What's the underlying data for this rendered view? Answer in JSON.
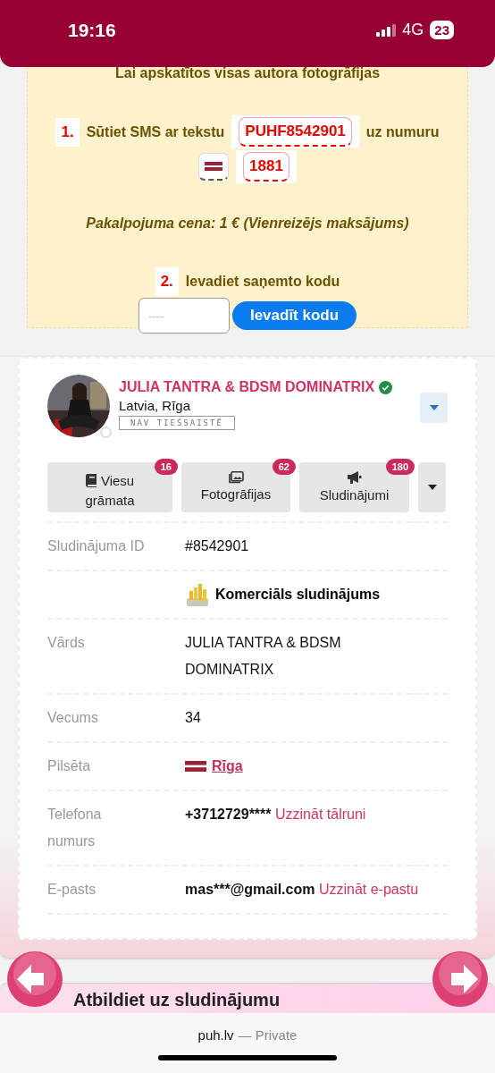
{
  "status_bar": {
    "time": "19:16",
    "network": "4G",
    "battery": "23"
  },
  "sms_box": {
    "heading": "Lai apskatītos visas autora fotogrāfijas",
    "step1": {
      "number": "1.",
      "text": "Sūtiet SMS ar tekstu",
      "code": "PUHF8542901",
      "after": "uz numuru",
      "phone": "1881"
    },
    "price": "Pakalpojuma cena: 1 € (Vienreizējs maksājums)",
    "step2": {
      "number": "2.",
      "text": "Ievadiet saņemto kodu",
      "placeholder": "----",
      "button": "Ievadīt kodu"
    }
  },
  "profile": {
    "name": "JULIA TANTRA & BDSM DOMINATRIX",
    "verified": true,
    "location": "Latvia, Rīga",
    "status": "NAV TIEŠSAISTĒ",
    "online": false,
    "tabs": [
      {
        "kind": "book",
        "label": "Viesu grāmata",
        "count": "16"
      },
      {
        "kind": "photos",
        "label": "Fotogrāfijas",
        "count": "62"
      },
      {
        "kind": "ads",
        "label": "Sludinājumi",
        "count": "180"
      }
    ]
  },
  "details": [
    {
      "kind": "text",
      "label": "Sludinājuma ID",
      "value": "#8542901"
    },
    {
      "kind": "commercial",
      "value": "Komerciāls sludinājums"
    },
    {
      "kind": "text",
      "label": "Vārds",
      "value": "JULIA TANTRA & BDSM DOMINATRIX"
    },
    {
      "kind": "text",
      "label": "Vecums",
      "value": "34"
    },
    {
      "kind": "city",
      "label": "Pilsēta",
      "value": "Rīga"
    },
    {
      "kind": "contact",
      "label": "Telefona numurs",
      "value": "+3712729****",
      "link": "Uzzināt tālruni"
    },
    {
      "kind": "contact",
      "label": "E-pasts",
      "value": "mas***@gmail.com",
      "link": "Uzzināt e-pastu"
    }
  ],
  "reply_heading": "Atbildiet uz sludinājumu",
  "browser": {
    "domain": "puh.lv",
    "mode": "— Private"
  }
}
